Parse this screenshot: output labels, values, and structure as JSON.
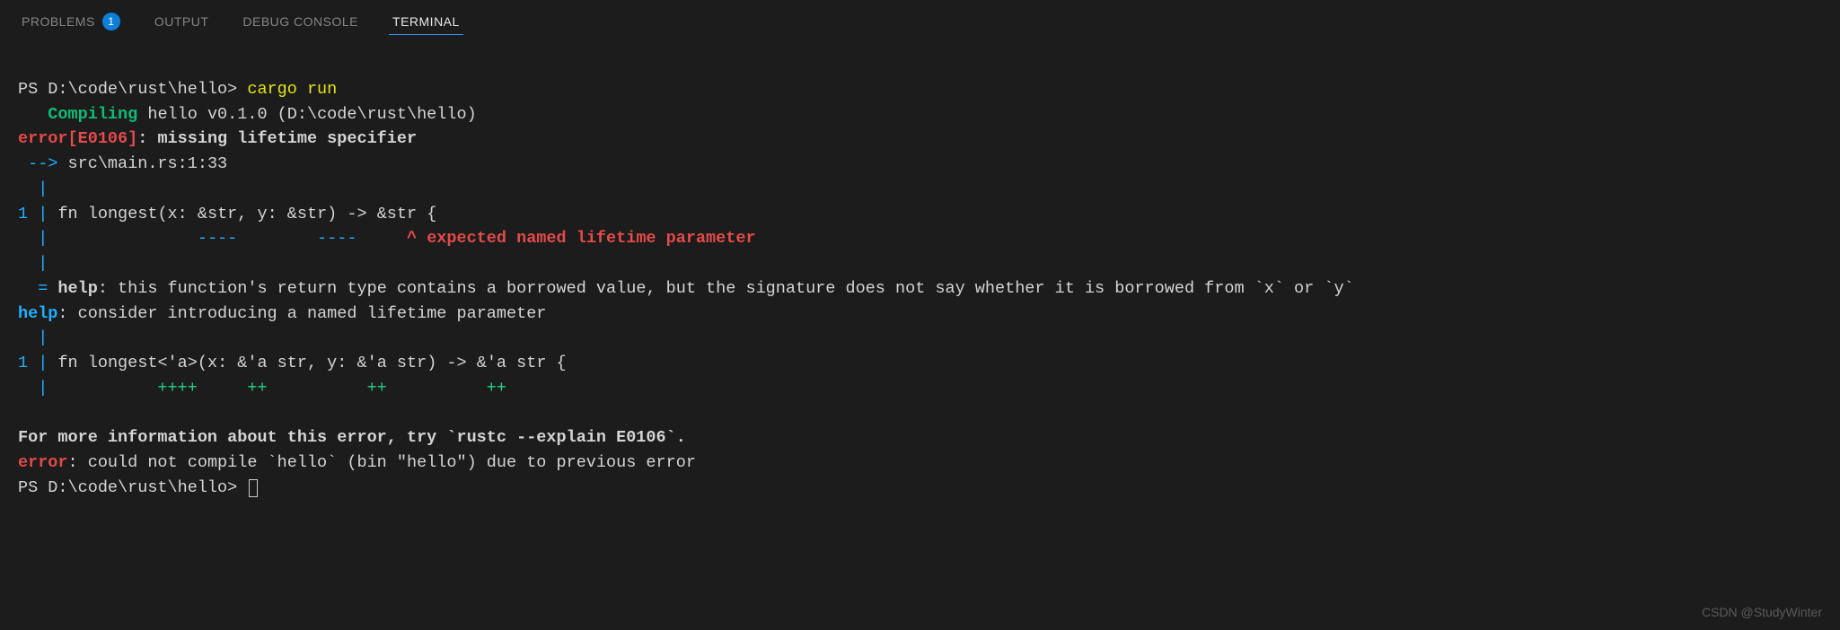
{
  "tabs": {
    "problems": {
      "label": "PROBLEMS",
      "count": "1"
    },
    "output": {
      "label": "OUTPUT"
    },
    "debug": {
      "label": "DEBUG CONSOLE"
    },
    "terminal": {
      "label": "TERMINAL"
    }
  },
  "term": {
    "prompt1_pre": "PS D:\\code\\rust\\hello> ",
    "prompt1_cmd": "cargo run",
    "compiling_label": "   Compiling",
    "compiling_rest": " hello v0.1.0 (D:\\code\\rust\\hello)",
    "err_code": "error[E0106]",
    "err_msg": ": missing lifetime specifier",
    "arrow": " --> ",
    "location": "src\\main.rs:1:33",
    "pipe1": "  |",
    "line_no": "1 ",
    "pipe2": "| ",
    "code_line1": "fn longest(x: &str, y: &str) -> &str {",
    "pipe3": "  |",
    "underline_dashes": "               ----        ----     ",
    "caret_msg": "^ expected named lifetime parameter",
    "pipe4": "  |",
    "eq_help": "  = ",
    "help_label": "help",
    "help_msg1": ": this function's return type contains a borrowed value, but the signature does not say whether it is borrowed from `x` or `y`",
    "help_label2": "help",
    "help_msg2": ": consider introducing a named lifetime parameter",
    "pipe5": "  |",
    "line_no2": "1 ",
    "pipe6": "| ",
    "code_line2": "fn longest<'a>(x: &'a str, y: &'a str) -> &'a str {",
    "pipe7": "  |",
    "plus_line": "           ++++     ++          ++          ++",
    "more_info": "For more information about this error, try `rustc --explain E0106`.",
    "error2": "error",
    "error2_msg": ": could not compile `hello` (bin \"hello\") due to previous error",
    "prompt2": "PS D:\\code\\rust\\hello> "
  },
  "watermark": "CSDN @StudyWinter"
}
